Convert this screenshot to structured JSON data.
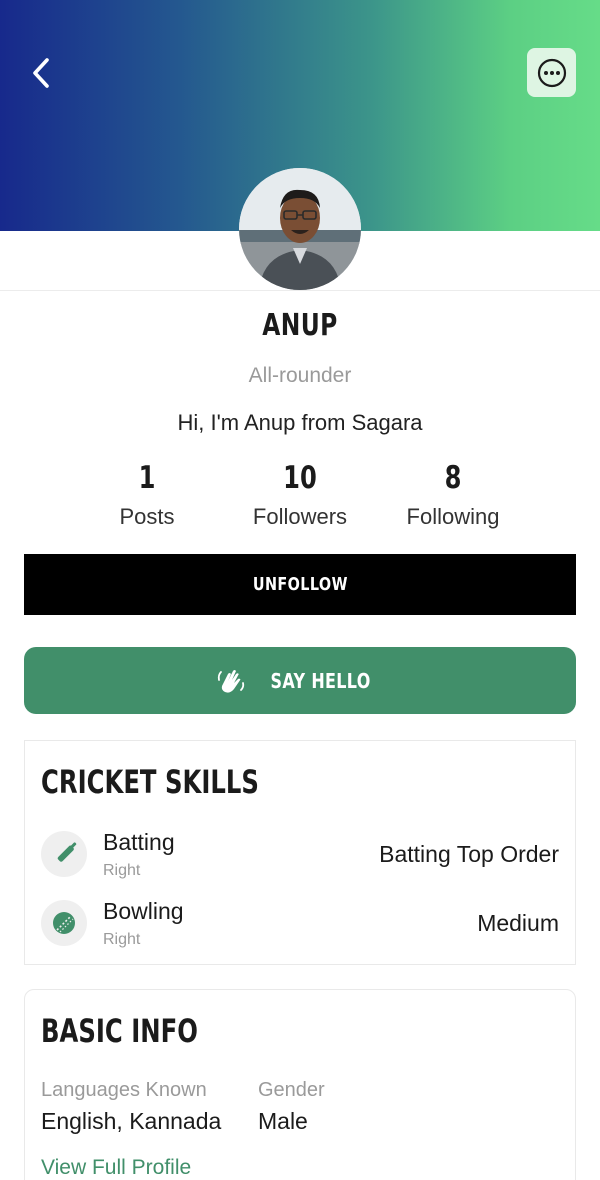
{
  "header": {
    "back_icon": "chevron-left-icon",
    "more_icon": "more-dots-icon",
    "gradient_start": "#17298c",
    "gradient_end": "#66dc88",
    "more_bg": "#def5e3"
  },
  "profile": {
    "name": "ANUP",
    "role": "All-rounder",
    "bio": "Hi, I'm Anup from Sagara"
  },
  "stats": [
    {
      "value": "1",
      "label": "Posts"
    },
    {
      "value": "10",
      "label": "Followers"
    },
    {
      "value": "8",
      "label": "Following"
    }
  ],
  "actions": {
    "unfollow_label": "UNFOLLOW",
    "say_hello_label": "SAY HELLO",
    "say_hello_icon": "waving-hands-icon",
    "primary_color": "#418f6a"
  },
  "cricket_skills": {
    "title": "CRICKET SKILLS",
    "items": [
      {
        "name": "Batting",
        "hand": "Right",
        "value": "Batting Top Order",
        "icon": "cricket-bat-icon"
      },
      {
        "name": "Bowling",
        "hand": "Right",
        "value": "Medium",
        "icon": "cricket-ball-icon"
      }
    ]
  },
  "basic_info": {
    "title": "BASIC INFO",
    "languages_label": "Languages Known",
    "languages_value": "English, Kannada",
    "gender_label": "Gender",
    "gender_value": "Male",
    "view_full_label": "View Full Profile"
  }
}
